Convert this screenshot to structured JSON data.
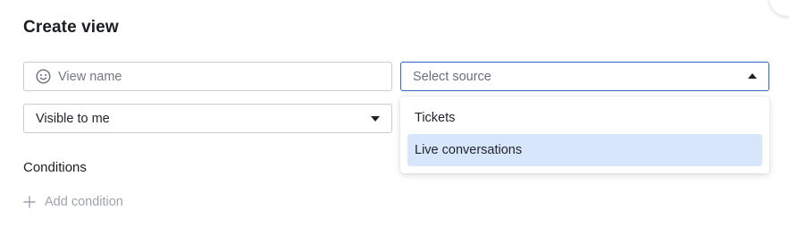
{
  "dialog": {
    "title": "Create view"
  },
  "view_name": {
    "placeholder": "View name",
    "value": "",
    "icon": "emoji-smile-icon"
  },
  "source": {
    "placeholder": "Select source",
    "expanded": true,
    "options": [
      {
        "label": "Tickets",
        "highlighted": false
      },
      {
        "label": "Live conversations",
        "highlighted": true
      }
    ]
  },
  "visibility": {
    "value": "Visible to me"
  },
  "conditions": {
    "heading": "Conditions",
    "add_label": "Add condition"
  },
  "colors": {
    "focus_border": "#2f64c8",
    "highlight": "#d8e6fb",
    "muted_text": "#9ea3ab"
  }
}
